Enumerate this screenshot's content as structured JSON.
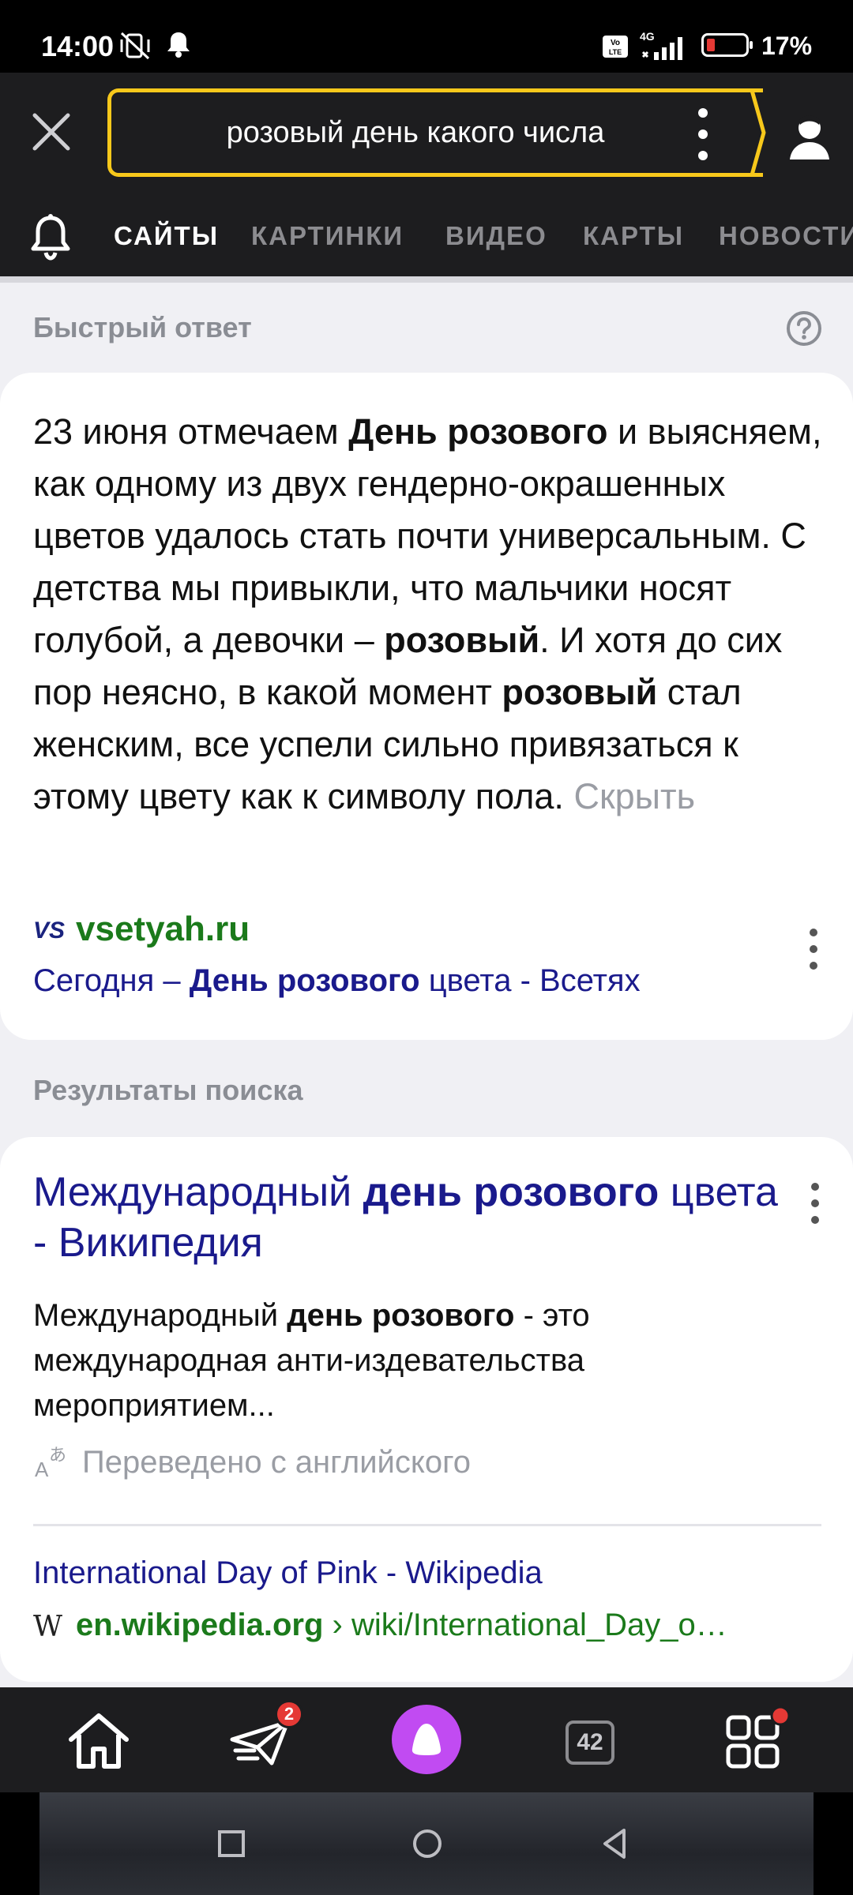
{
  "status_bar": {
    "time": "14:00",
    "network": "4G",
    "battery_pct": "17%"
  },
  "search": {
    "query": "розовый день какого числа"
  },
  "tabs": [
    {
      "label": "САЙТЫ",
      "active": true
    },
    {
      "label": "КАРТИНКИ",
      "active": false
    },
    {
      "label": "ВИДЕО",
      "active": false
    },
    {
      "label": "КАРТЫ",
      "active": false
    },
    {
      "label": "НОВОСТИ",
      "active": false
    }
  ],
  "quick_answer": {
    "section_title": "Быстрый ответ",
    "text_parts": [
      {
        "text": "23 июня отмечаем ",
        "bold": false
      },
      {
        "text": "День розового",
        "bold": true
      },
      {
        "text": " и выясняем, как одному из двух гендерно-окрашенных цветов удалось стать почти универсальным. С детства мы привыкли, что мальчики носят голубой, а девочки – ",
        "bold": false
      },
      {
        "text": "розовый",
        "bold": true
      },
      {
        "text": ". И хотя до сих пор неясно, в какой момент ",
        "bold": false
      },
      {
        "text": "розовый",
        "bold": true
      },
      {
        "text": " стал женским, все успели сильно привязаться к этому цвету как к символу пола.",
        "bold": false
      }
    ],
    "hide_label": "Скрыть",
    "source_logo": "VS",
    "source_domain": "vsetyah.ru",
    "source_title_parts": [
      {
        "text": "Сегодня – ",
        "bold": false
      },
      {
        "text": "День розового",
        "bold": true
      },
      {
        "text": " цвета - Всетях",
        "bold": false
      }
    ]
  },
  "results": {
    "section_title": "Результаты поиска",
    "items": [
      {
        "title_parts": [
          {
            "text": "Международный ",
            "bold": false
          },
          {
            "text": "день розового",
            "bold": true
          },
          {
            "text": " цвета - Википедия",
            "bold": false
          }
        ],
        "snippet_parts": [
          {
            "text": "Международный ",
            "bold": false
          },
          {
            "text": "день розового",
            "bold": true
          },
          {
            "text": " - это международная анти-издевательства мероприятием...",
            "bold": false
          }
        ],
        "translated_label": "Переведено с английского",
        "original_title": "International Day of Pink - Wikipedia",
        "favicon": "W",
        "domain": "en.wikipedia.org",
        "path": " › wiki/International_Day_o…"
      }
    ]
  },
  "bottom_nav": {
    "messages_badge": "2",
    "tabs_count": "42"
  },
  "colors": {
    "accent_yellow": "#f7c81b",
    "link_blue": "#1a1a8c",
    "domain_green": "#1b7a1b",
    "alice_purple": "#c14bf2",
    "badge_red": "#e53935"
  }
}
